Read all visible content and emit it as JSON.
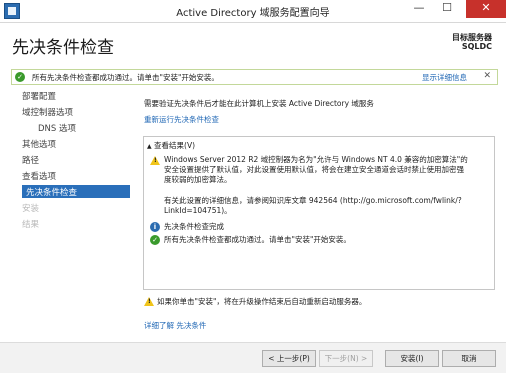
{
  "window": {
    "title": "Active Directory 域服务配置向导",
    "minimize": "—",
    "maximize": "☐",
    "close": "✕"
  },
  "header": {
    "page_title": "先决条件检查",
    "target_label": "目标服务器",
    "target_value": "SQLDC"
  },
  "banner": {
    "message": "所有先决条件检查都成功通过。请单击\"安装\"开始安装。",
    "details_link": "显示详细信息",
    "close": "✕"
  },
  "nav": {
    "items": [
      {
        "label": "部署配置",
        "state": "normal"
      },
      {
        "label": "域控制器选项",
        "state": "normal"
      },
      {
        "label": "DNS 选项",
        "state": "sub"
      },
      {
        "label": "其他选项",
        "state": "normal"
      },
      {
        "label": "路径",
        "state": "normal"
      },
      {
        "label": "查看选项",
        "state": "normal"
      },
      {
        "label": "先决条件检查",
        "state": "selected"
      },
      {
        "label": "安装",
        "state": "disabled"
      },
      {
        "label": "结果",
        "state": "disabled"
      }
    ]
  },
  "main": {
    "intro": "需要验证先决条件后才能在此计算机上安装 Active Directory 域服务",
    "rerun_link": "重新运行先决条件检查",
    "results": {
      "header": "查看结果(V)",
      "warning_lines": [
        "Windows Server 2012 R2 域控制器为名为\"允许与 Windows NT 4.0 兼容的加密算法\"的",
        "安全设置提供了默认值，对此设置使用默认值，将会在建立安全通道会话时禁止使用加密强",
        "度较弱的加密算法。"
      ],
      "kb_lines": [
        "有关此设置的详细信息，请参阅知识库文章 942564 (http://go.microsoft.com/fwlink/?",
        "LinkId=104751)。"
      ],
      "info_line": "先决条件检查完成",
      "success_line": "所有先决条件检查都成功通过。请单击\"安装\"开始安装。"
    },
    "restart_warning": "如果你单击\"安装\"，将在升级操作结束后自动重新启动服务器。",
    "learn_more": "详细了解 先决条件"
  },
  "buttons": {
    "previous": "< 上一步(P)",
    "next": "下一步(N) >",
    "install": "安装(I)",
    "cancel": "取消"
  }
}
